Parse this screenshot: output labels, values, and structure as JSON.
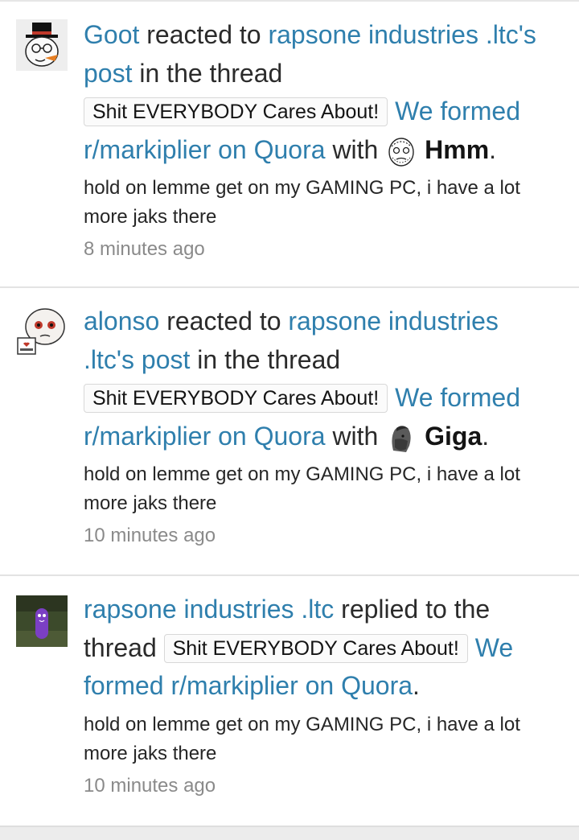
{
  "alerts": [
    {
      "user": "Goot",
      "verb": " reacted to ",
      "owner_link": "rapsone industries .ltc's post",
      "mid": " in the thread ",
      "prefix": "Shit EVERYBODY Cares About!",
      "thread": "We formed r/markiplier on Quora",
      "with": " with ",
      "reaction_icon": "hmm-face-icon",
      "reaction": "Hmm",
      "end": ".",
      "snippet": "hold on lemme get on my GAMING PC, i have a lot more jaks there",
      "time": "8 minutes ago"
    },
    {
      "user": "alonso",
      "verb": " reacted to ",
      "owner_link": "rapsone industries .ltc's post",
      "mid": " in the thread ",
      "prefix": "Shit EVERYBODY Cares About!",
      "thread": "We formed r/markiplier on Quora",
      "with": " with ",
      "reaction_icon": "giga-face-icon",
      "reaction": "Giga",
      "end": ".",
      "snippet": "hold on lemme get on my GAMING PC, i have a lot more jaks there",
      "time": "10 minutes ago"
    },
    {
      "user": "rapsone industries .ltc",
      "verb": " replied to the thread ",
      "prefix": "Shit EVERYBODY Cares About!",
      "thread": "We formed r/markiplier on Quora",
      "end": ".",
      "snippet": "hold on lemme get on my GAMING PC, i have a lot more jaks there",
      "time": "10 minutes ago"
    }
  ],
  "colors": {
    "link": "#2f7fad",
    "text": "#2b2b2b",
    "muted": "#8a8a8a",
    "divider": "#e3e3e3"
  }
}
